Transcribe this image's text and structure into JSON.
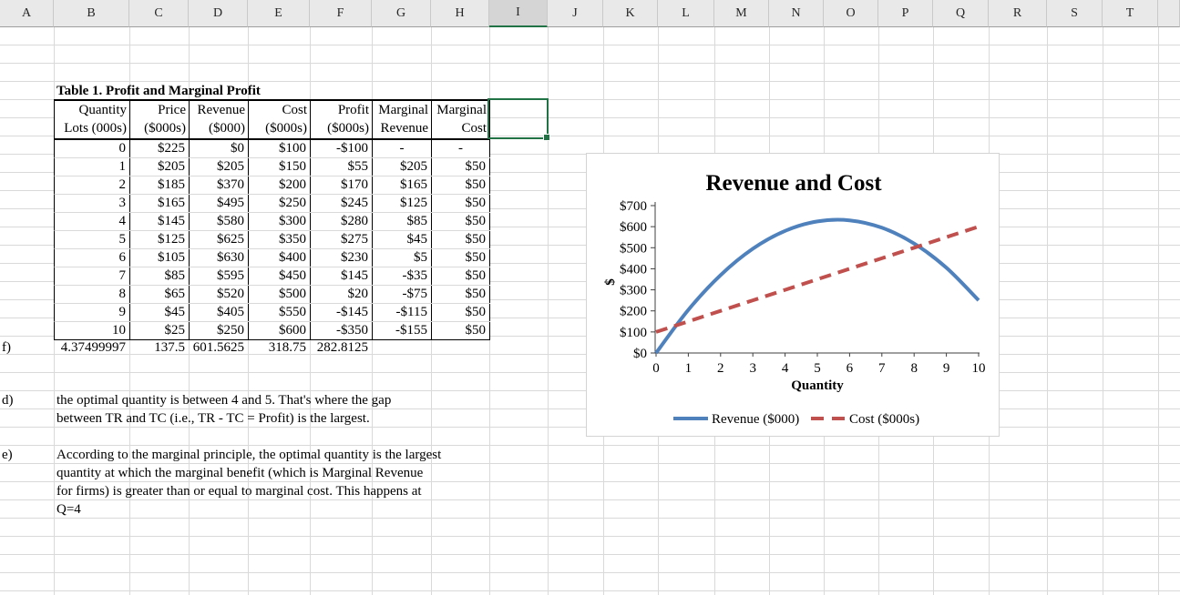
{
  "columns": [
    "A",
    "B",
    "C",
    "D",
    "E",
    "F",
    "G",
    "H",
    "I",
    "J",
    "K",
    "L",
    "M",
    "N",
    "O",
    "P",
    "Q",
    "R",
    "S",
    "T",
    ""
  ],
  "selected_column": "I",
  "table": {
    "title": "Table 1. Profit and Marginal Profit",
    "col_headers": [
      {
        "line1": "Quantity",
        "line2": "Lots (000s)"
      },
      {
        "line1": "Price",
        "line2": "($000s)"
      },
      {
        "line1": "Revenue",
        "line2": "($000)"
      },
      {
        "line1": "Cost",
        "line2": "($000s)"
      },
      {
        "line1": "Profit",
        "line2": "($000s)"
      },
      {
        "line1": "Marginal",
        "line2": "Revenue"
      },
      {
        "line1": "Marginal",
        "line2": "Cost"
      }
    ],
    "rows": [
      [
        "0",
        "$225",
        "$0",
        "$100",
        "-$100",
        "-",
        "-"
      ],
      [
        "1",
        "$205",
        "$205",
        "$150",
        "$55",
        "$205",
        "$50"
      ],
      [
        "2",
        "$185",
        "$370",
        "$200",
        "$170",
        "$165",
        "$50"
      ],
      [
        "3",
        "$165",
        "$495",
        "$250",
        "$245",
        "$125",
        "$50"
      ],
      [
        "4",
        "$145",
        "$580",
        "$300",
        "$280",
        "$85",
        "$50"
      ],
      [
        "5",
        "$125",
        "$625",
        "$350",
        "$275",
        "$45",
        "$50"
      ],
      [
        "6",
        "$105",
        "$630",
        "$400",
        "$230",
        "$5",
        "$50"
      ],
      [
        "7",
        "$85",
        "$595",
        "$450",
        "$145",
        "-$35",
        "$50"
      ],
      [
        "8",
        "$65",
        "$520",
        "$500",
        "$20",
        "-$75",
        "$50"
      ],
      [
        "9",
        "$45",
        "$405",
        "$550",
        "-$145",
        "-$115",
        "$50"
      ],
      [
        "10",
        "$25",
        "$250",
        "$600",
        "-$350",
        "-$155",
        "$50"
      ]
    ],
    "f_row": {
      "label": "f)",
      "values": [
        "4.37499997",
        "137.5",
        "601.5625",
        "318.75",
        "282.8125",
        "",
        ""
      ]
    }
  },
  "notes": [
    {
      "label": "d)",
      "lines": [
        "the optimal quantity is between 4 and 5. That's where the gap",
        "between TR and TC (i.e., TR - TC = Profit) is the largest."
      ]
    },
    {
      "label": "e)",
      "lines": [
        "According to the marginal principle, the optimal quantity is the largest",
        "quantity at which the marginal benefit (which is Marginal Revenue",
        "for firms) is greater than or equal to marginal cost. This happens at",
        "Q=4"
      ]
    }
  ],
  "chart_data": {
    "type": "line",
    "title": "Revenue and Cost",
    "xlabel": "Quantity",
    "ylabel": "$",
    "x": [
      0,
      1,
      2,
      3,
      4,
      5,
      6,
      7,
      8,
      9,
      10
    ],
    "xlim": [
      0,
      10
    ],
    "ylim": [
      0,
      700
    ],
    "ytick_step": 100,
    "ytick_labels": [
      "$0",
      "$100",
      "$200",
      "$300",
      "$400",
      "$500",
      "$600",
      "$700"
    ],
    "xtick_labels": [
      "0",
      "1",
      "2",
      "3",
      "4",
      "5",
      "6",
      "7",
      "8",
      "9",
      "10"
    ],
    "grid": false,
    "legend_position": "bottom",
    "series": [
      {
        "name": "Revenue ($000)",
        "color": "#4F81BD",
        "dash": "solid",
        "smooth": true,
        "values": [
          0,
          205,
          370,
          495,
          580,
          625,
          630,
          595,
          520,
          405,
          250
        ]
      },
      {
        "name": "Cost ($000s)",
        "color": "#C0504D",
        "dash": "dashed",
        "smooth": false,
        "values": [
          100,
          150,
          200,
          250,
          300,
          350,
          400,
          450,
          500,
          550,
          600
        ]
      }
    ]
  },
  "colors": {
    "selection": "#217346",
    "grid_line": "#D9D9D9",
    "table_border": "#000000",
    "header_bg": "#E9E9E9",
    "selected_header_bg": "#D5D5D5",
    "revenue": "#4F81BD",
    "cost": "#C0504D"
  }
}
